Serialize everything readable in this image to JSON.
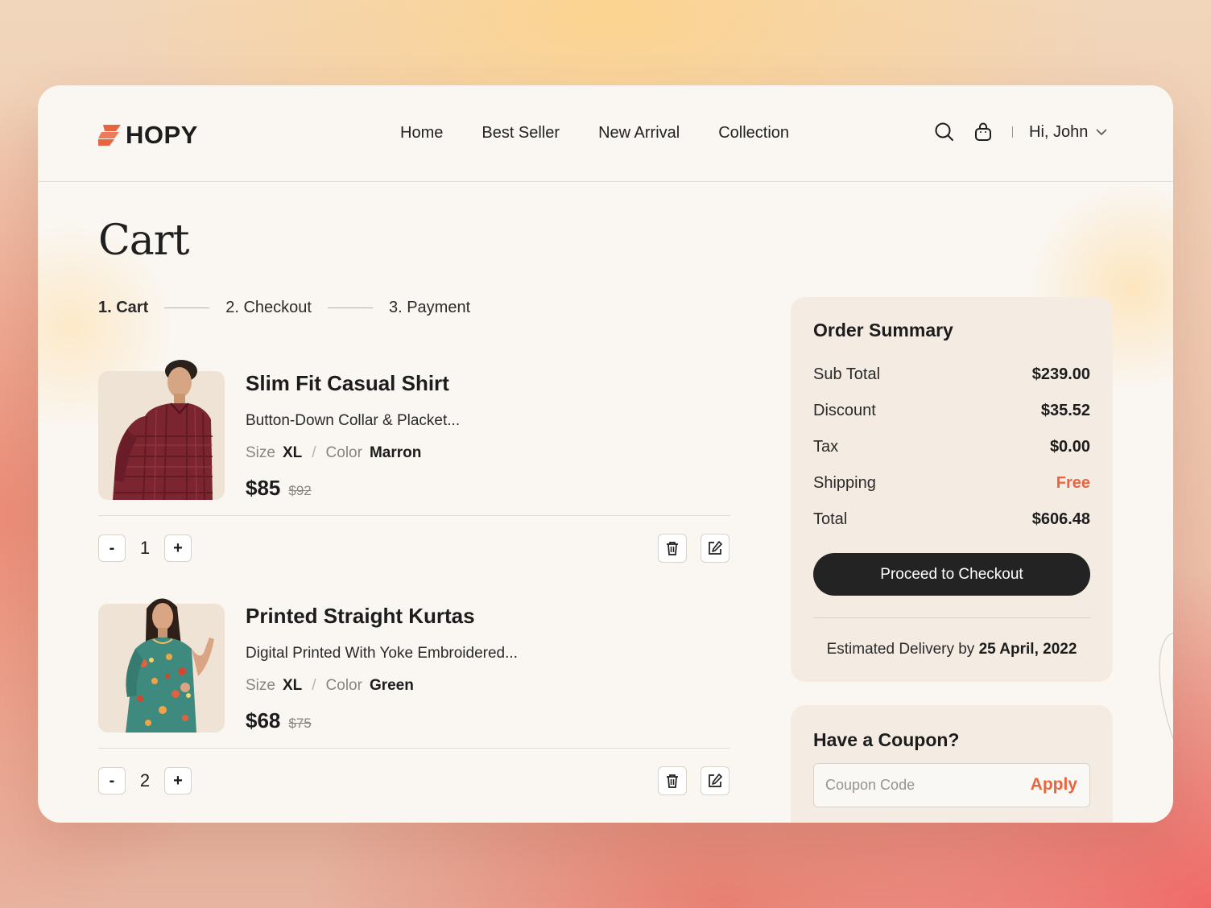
{
  "brand": {
    "name": "HOPY",
    "accent": "#e8653f"
  },
  "nav": {
    "items": [
      "Home",
      "Best Seller",
      "New Arrival",
      "Collection"
    ]
  },
  "header": {
    "greeting": "Hi, John"
  },
  "page": {
    "title": "Cart"
  },
  "steps": [
    "1. Cart",
    "2. Checkout",
    "3. Payment"
  ],
  "cart": {
    "items": [
      {
        "name": "Slim Fit Casual Shirt",
        "description": "Button-Down Collar & Placket...",
        "size_label": "Size",
        "size": "XL",
        "color_label": "Color",
        "color": "Marron",
        "price": "$85",
        "old_price": "$92",
        "quantity": "1"
      },
      {
        "name": "Printed Straight Kurtas",
        "description": "Digital Printed With Yoke Embroidered...",
        "size_label": "Size",
        "size": "XL",
        "color_label": "Color",
        "color": "Green",
        "price": "$68",
        "old_price": "$75",
        "quantity": "2"
      }
    ],
    "minus_label": "-",
    "plus_label": "+"
  },
  "summary": {
    "title": "Order Summary",
    "rows": [
      {
        "label": "Sub Total",
        "value": "$239.00"
      },
      {
        "label": "Discount",
        "value": "$35.52"
      },
      {
        "label": "Tax",
        "value": "$0.00"
      },
      {
        "label": "Shipping",
        "value": "Free"
      },
      {
        "label": "Total",
        "value": "$606.48"
      }
    ],
    "checkout_label": "Proceed to Checkout",
    "delivery_prefix": "Estimated Delivery by",
    "delivery_date": "25 April, 2022"
  },
  "coupon": {
    "title": "Have a Coupon?",
    "placeholder": "Coupon Code",
    "apply_label": "Apply"
  }
}
